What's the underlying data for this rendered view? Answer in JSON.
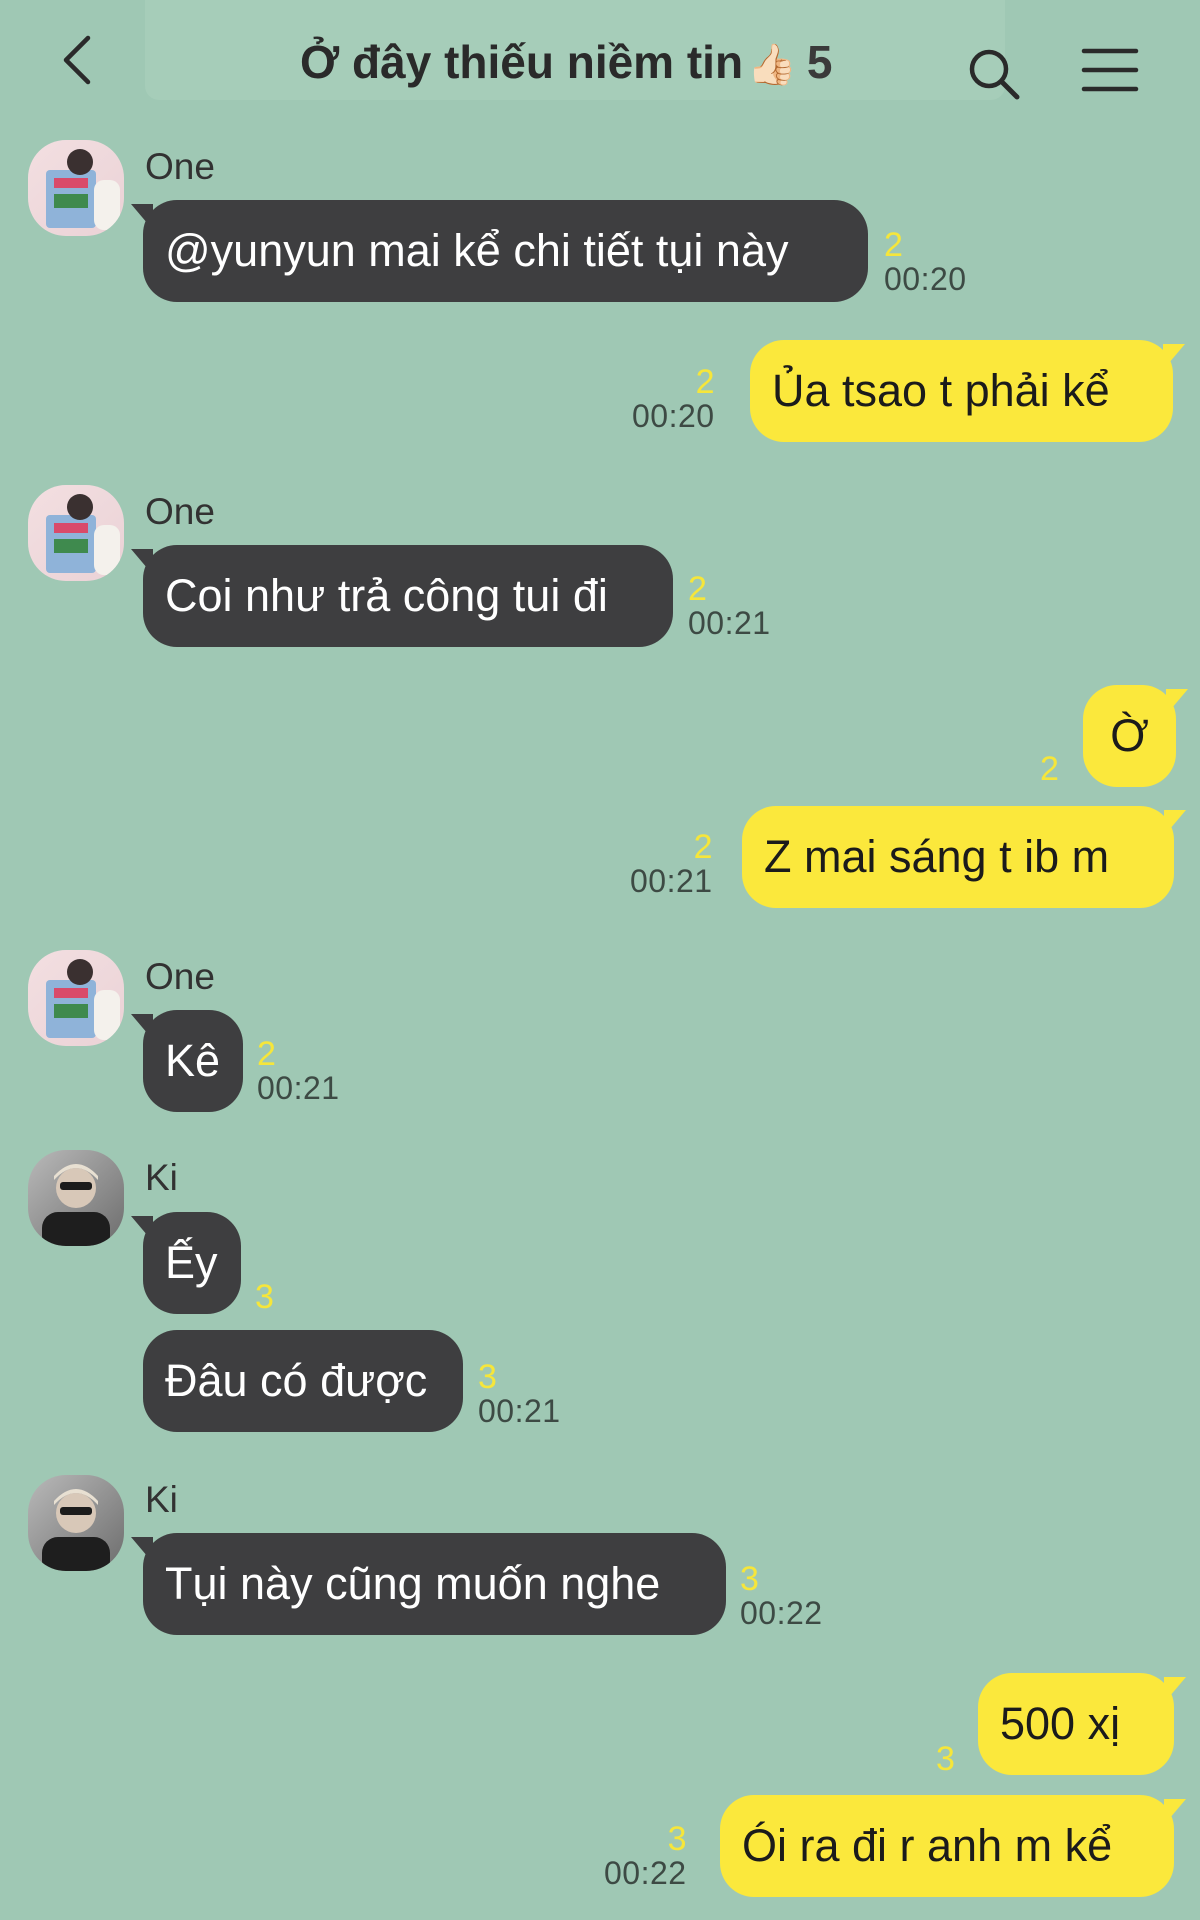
{
  "header": {
    "title": "Ở đây thiếu niềm tin",
    "emoji": "👍🏻",
    "member_count": "5",
    "back_icon": "chevron-left-icon",
    "search_icon": "search-icon",
    "menu_icon": "hamburger-menu-icon"
  },
  "colors": {
    "background": "#9fc8b4",
    "incoming_bubble": "#3e3e40",
    "outgoing_bubble": "#fbe83c",
    "read_count": "#f6e63a"
  },
  "messages": [
    {
      "sender": "One",
      "text": "@yunyun mai kể chi tiết tụi này",
      "read": "2",
      "time": "00:20",
      "side": "in"
    },
    {
      "text": "Ủa tsao t phải kể",
      "read": "2",
      "time": "00:20",
      "side": "out"
    },
    {
      "sender": "One",
      "text": "Coi như trả công tui đi",
      "read": "2",
      "time": "00:21",
      "side": "in"
    },
    {
      "text": "Ờ",
      "read": "2",
      "time": "",
      "side": "out"
    },
    {
      "text": "Z mai sáng t ib m",
      "read": "2",
      "time": "00:21",
      "side": "out"
    },
    {
      "sender": "One",
      "text": "Kê",
      "read": "2",
      "time": "00:21",
      "side": "in"
    },
    {
      "sender": "Ki",
      "text": "Ếy",
      "read": "3",
      "time": "",
      "side": "in"
    },
    {
      "text": "Đâu có được",
      "read": "3",
      "time": "00:21",
      "side": "in"
    },
    {
      "sender": "Ki",
      "text": "Tụi này cũng muốn nghe",
      "read": "3",
      "time": "00:22",
      "side": "in"
    },
    {
      "text": "500 xị",
      "read": "3",
      "time": "",
      "side": "out"
    },
    {
      "text": "Ói ra đi r anh m kể",
      "read": "3",
      "time": "00:22",
      "side": "out"
    }
  ]
}
